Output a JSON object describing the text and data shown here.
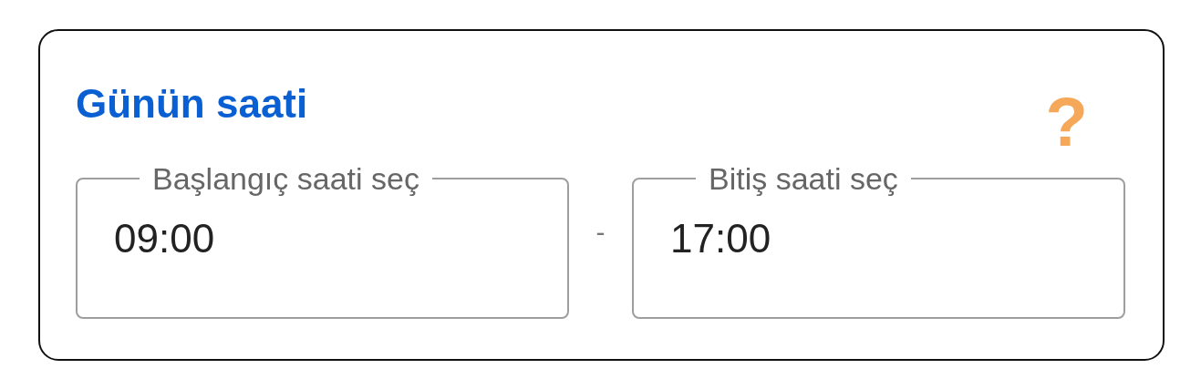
{
  "card": {
    "title": "Günün saati",
    "help_icon": "?",
    "fields": [
      {
        "label": "Başlangıç saati seç",
        "value": "09:00"
      },
      {
        "label": "Bitiş saati seç",
        "value": "17:00"
      }
    ],
    "separator": "-"
  }
}
